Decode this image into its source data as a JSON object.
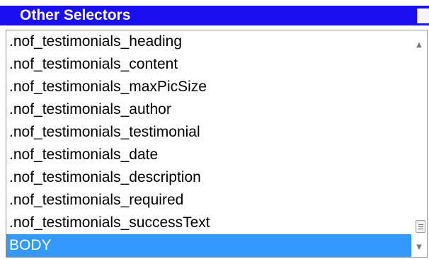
{
  "header": {
    "title": "Other Selectors"
  },
  "selectors": {
    "items": [
      ".nof_testimonials_heading",
      ".nof_testimonials_content",
      ".nof_testimonials_maxPicSize",
      ".nof_testimonials_author",
      ".nof_testimonials_testimonial",
      ".nof_testimonials_date",
      ".nof_testimonials_description",
      ".nof_testimonials_required",
      ".nof_testimonials_successText",
      "BODY"
    ],
    "selected": "BODY"
  },
  "colors": {
    "header_bg": "#1a0ff0",
    "selection_bg": "#3399ff"
  },
  "icons": {
    "scroll_up": "triangle-up-icon",
    "scroll_down": "triangle-down-icon",
    "scroll_thumb": "scroll-grip-icon"
  }
}
